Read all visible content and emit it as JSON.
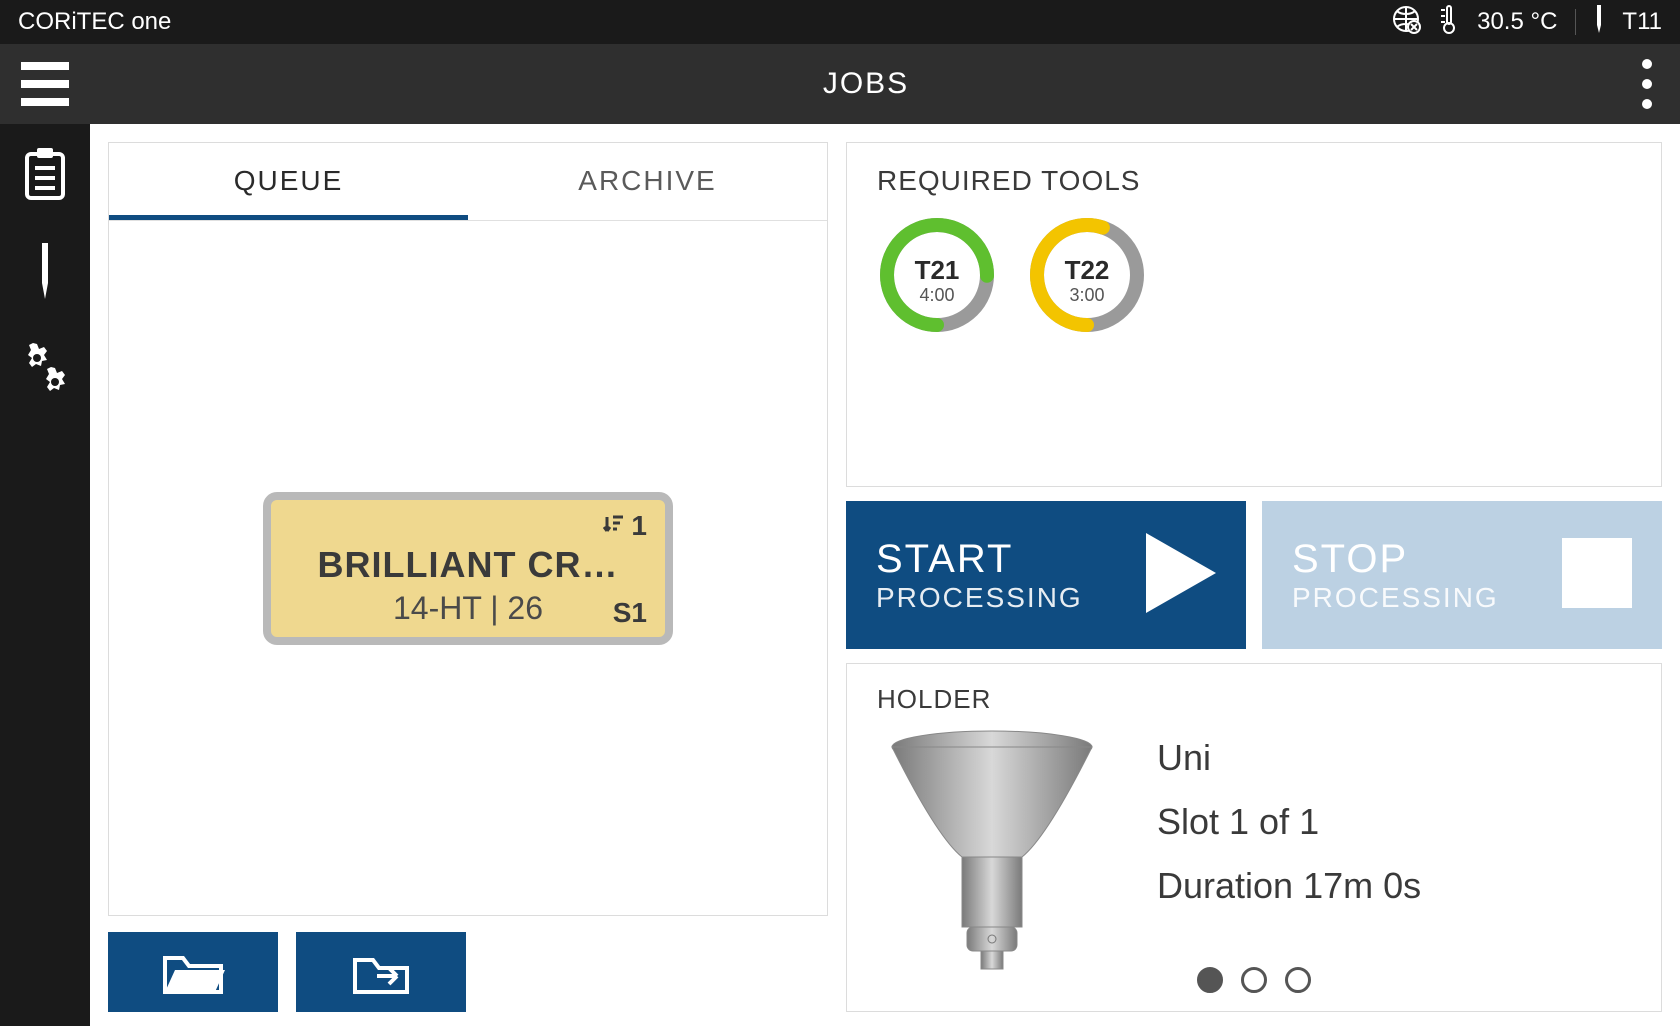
{
  "status": {
    "app_name": "CORiTEC one",
    "temperature": "30.5 °C",
    "tool": "T11"
  },
  "header": {
    "title": "JOBS"
  },
  "tabs": {
    "queue": "QUEUE",
    "archive": "ARCHIVE"
  },
  "job_card": {
    "name": "BRILLIANT CR…",
    "sub": "14-HT  |  26",
    "order": "1",
    "slot": "S1"
  },
  "required_tools": {
    "heading": "REQUIRED TOOLS",
    "tools": [
      {
        "label": "T21",
        "time": "4:00",
        "color": "#5fbf2f",
        "percent": 75
      },
      {
        "label": "T22",
        "time": "3:00",
        "color": "#f3c400",
        "percent": 55
      }
    ]
  },
  "processing": {
    "start_main": "START",
    "start_sub": "PROCESSING",
    "stop_main": "STOP",
    "stop_sub": "PROCESSING"
  },
  "holder": {
    "heading": "HOLDER",
    "name": "Uni",
    "slot": "Slot  1  of  1",
    "duration": "Duration  17m 0s"
  }
}
